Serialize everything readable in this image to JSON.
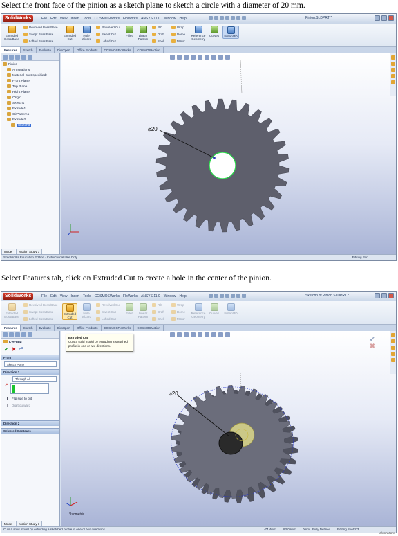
{
  "captions": {
    "step1": "Select the front face of the pinion as a sketch plane to sketch a circle with a diameter of 20 mm.",
    "step2": "Select Features tab, click on Extruded Cut to create a hole in the center of the pinion."
  },
  "app": {
    "logo": "SolidWorks",
    "menus": [
      "File",
      "Edit",
      "View",
      "Insert",
      "Tools",
      "COSMOSWorks",
      "FloWorks",
      "ANSYS 11.0",
      "Window",
      "Help"
    ]
  },
  "cm_labels": {
    "extruded_boss": "Extruded Boss/Base",
    "revolved_boss": "Revolved Boss/Base",
    "swept_boss": "Swept Boss/Base",
    "lofted_boss": "Lofted Boss/Base",
    "extruded_cut": "Extruded Cut",
    "hole_wizard": "Hole Wizard",
    "revolved_cut": "Revolved Cut",
    "swept_cut": "Swept Cut",
    "lofted_cut": "Lofted Cut",
    "fillet": "Fillet",
    "linear_pattern": "Linear Pattern",
    "rib": "Rib",
    "draft": "Draft",
    "shell": "Shell",
    "wrap": "Wrap",
    "dome": "Dome",
    "mirror": "Mirror",
    "reference_geometry": "Reference Geometry",
    "curves": "Curves",
    "instant3d": "Instant3D"
  },
  "tabs": [
    "Features",
    "Sketch",
    "Evaluate",
    "DimXpert",
    "Office Products",
    "COSMOSFloWorks",
    "COSMOSMotion"
  ],
  "screen1": {
    "doc_title": "Pinion.SLDPRT *",
    "tree": [
      "Pinion",
      "Annotations",
      "Material <not specified>",
      "Front Plane",
      "Top Plane",
      "Right Plane",
      "Origin",
      "Sketch1",
      "Extrude1",
      "CirPattern1",
      "Extrude2",
      "Sketch3"
    ],
    "dimension": "⌀20",
    "bottom_tabs": [
      "Model",
      "Motion Study 1"
    ],
    "status_left": "SolidWorks Education Edition - Instructional Use Only",
    "status_right": "Editing Part"
  },
  "screen2": {
    "doc_title": "Sketch3 of Pinion.SLDPRT *",
    "pm_title": "Extrude",
    "from_head": "From",
    "from_value": "Sketch Plane",
    "dir1_head": "Direction 1",
    "dir1_value": "Through All",
    "flip_label": "Flip side to cut",
    "draft_label": "Draft outward",
    "dir2_head": "Direction 2",
    "contours_head": "Selected Contours",
    "tooltip_title": "Extruded Cut",
    "tooltip_body": "Cuts a solid model by extruding a sketched profile in one or two directions.",
    "dimension": "⌀20",
    "view_label": "*Isometric",
    "bottom_tabs": [
      "Model",
      "Motion Study 1"
    ],
    "status_left": "Cuts a solid model by extruding a sketched profile in one or two directions.",
    "status_x": "-74.4mm",
    "status_y": "83.05mm",
    "status_z": "0mm",
    "status_def": "Fully Defined",
    "status_edit": "Editing Sketch3"
  },
  "credit": "Illustrations"
}
